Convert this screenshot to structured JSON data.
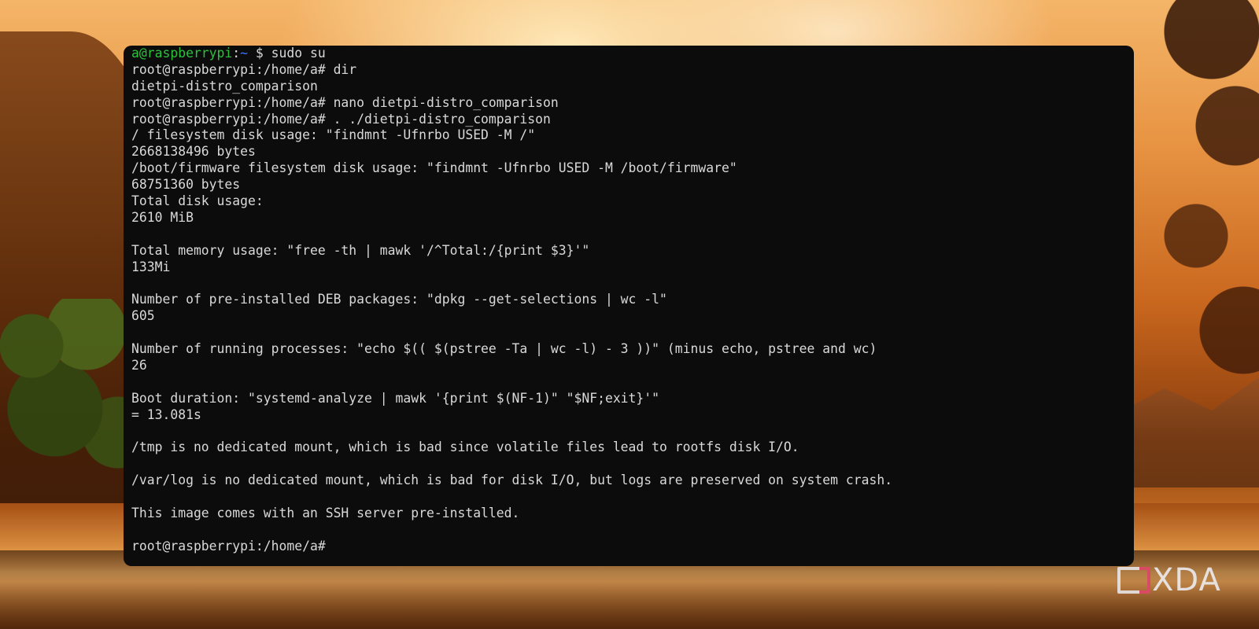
{
  "terminal": {
    "prompt1": {
      "user": "a@raspberrypi",
      "colon": ":",
      "path": "~",
      "dollar": " $",
      "command": " sudo su"
    },
    "lines": [
      "root@raspberrypi:/home/a# dir",
      "dietpi-distro_comparison",
      "root@raspberrypi:/home/a# nano dietpi-distro_comparison",
      "root@raspberrypi:/home/a# . ./dietpi-distro_comparison",
      "/ filesystem disk usage: \"findmnt -Ufnrbo USED -M /\"",
      "2668138496 bytes",
      "/boot/firmware filesystem disk usage: \"findmnt -Ufnrbo USED -M /boot/firmware\"",
      "68751360 bytes",
      "Total disk usage:",
      "2610 MiB",
      "",
      "Total memory usage: \"free -th | mawk '/^Total:/{print $3}'\"",
      "133Mi",
      "",
      "Number of pre-installed DEB packages: \"dpkg --get-selections | wc -l\"",
      "605",
      "",
      "Number of running processes: \"echo $(( $(pstree -Ta | wc -l) - 3 ))\" (minus echo, pstree and wc)",
      "26",
      "",
      "Boot duration: \"systemd-analyze | mawk '{print $(NF-1)\" \"$NF;exit}'\"",
      "= 13.081s",
      "",
      "/tmp is no dedicated mount, which is bad since volatile files lead to rootfs disk I/O.",
      "",
      "/var/log is no dedicated mount, which is bad for disk I/O, but logs are preserved on system crash.",
      "",
      "This image comes with an SSH server pre-installed.",
      "",
      "root@raspberrypi:/home/a#"
    ]
  },
  "watermark": {
    "text": "XDA"
  },
  "colors": {
    "terminal_bg": "#0c0c0c",
    "prompt_user": "#2bc23b",
    "prompt_path": "#3a78ff",
    "text": "#d9d9d9"
  }
}
